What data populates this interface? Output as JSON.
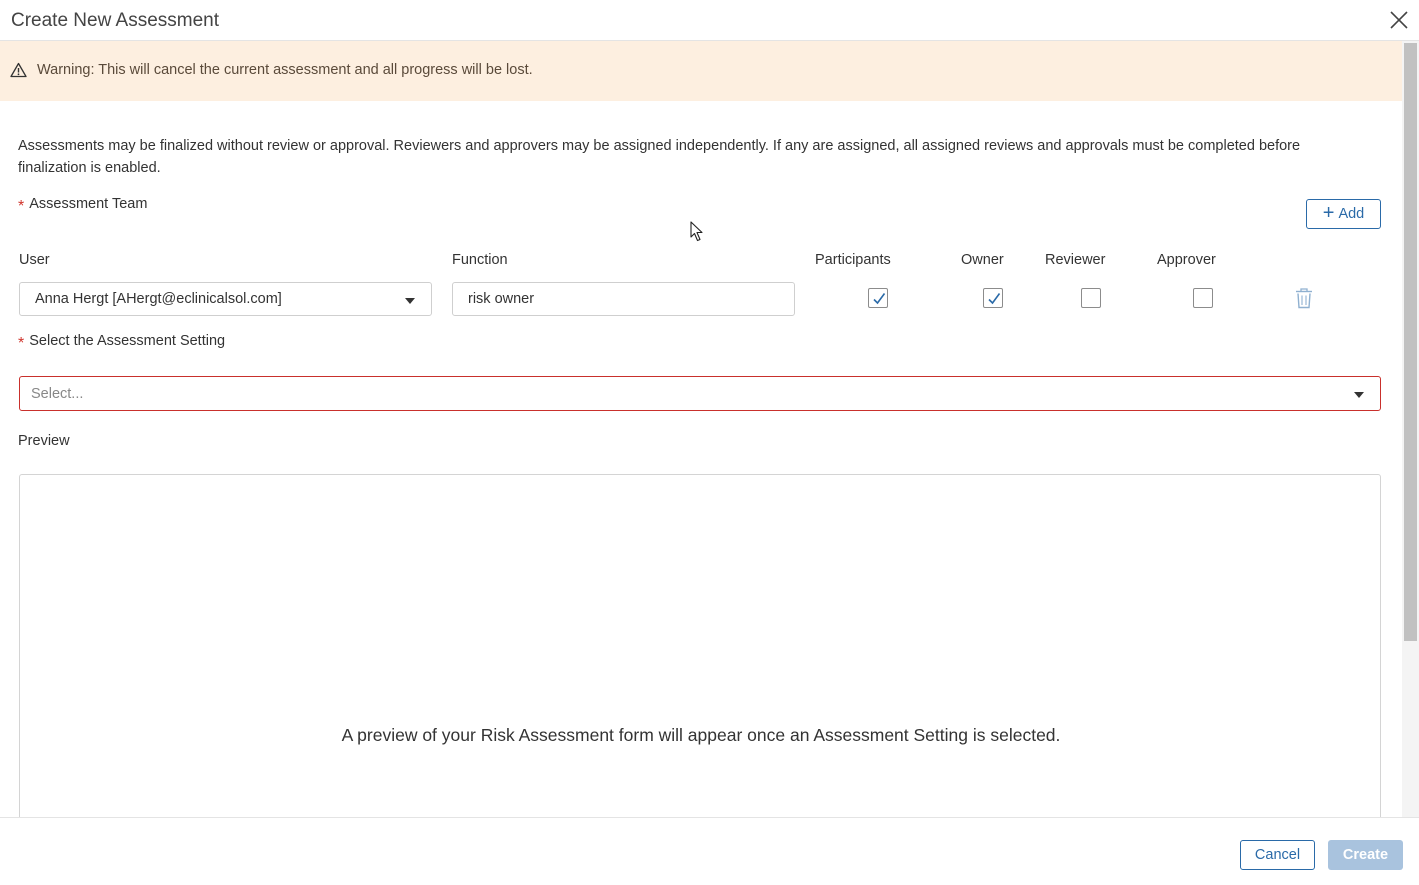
{
  "dialog": {
    "title": "Create New Assessment"
  },
  "warning": {
    "text": "Warning: This will cancel the current assessment and all progress will be lost."
  },
  "info": {
    "text": "Assessments may be finalized without review or approval. Reviewers and approvers may be assigned independently. If any are assigned, all assigned reviews and approvals must be completed before finalization is enabled."
  },
  "team": {
    "label": "Assessment Team",
    "add_label": "Add",
    "columns": {
      "user": "User",
      "function": "Function",
      "participants": "Participants",
      "owner": "Owner",
      "reviewer": "Reviewer",
      "approver": "Approver"
    },
    "rows": [
      {
        "user": "Anna Hergt [AHergt@eclinicalsol.com]",
        "function": "risk owner",
        "participants": true,
        "owner": true,
        "reviewer": false,
        "approver": false
      }
    ]
  },
  "setting": {
    "label": "Select the Assessment Setting",
    "placeholder": "Select..."
  },
  "preview": {
    "label": "Preview",
    "message": "A preview of your Risk Assessment form will appear once an Assessment Setting is selected."
  },
  "footer": {
    "cancel_label": "Cancel",
    "create_label": "Create"
  },
  "colors": {
    "accent": "#2a6aa8",
    "warning_bg": "#fdefe0",
    "error_border": "#c9302c",
    "disabled_button": "#a9c3de"
  }
}
